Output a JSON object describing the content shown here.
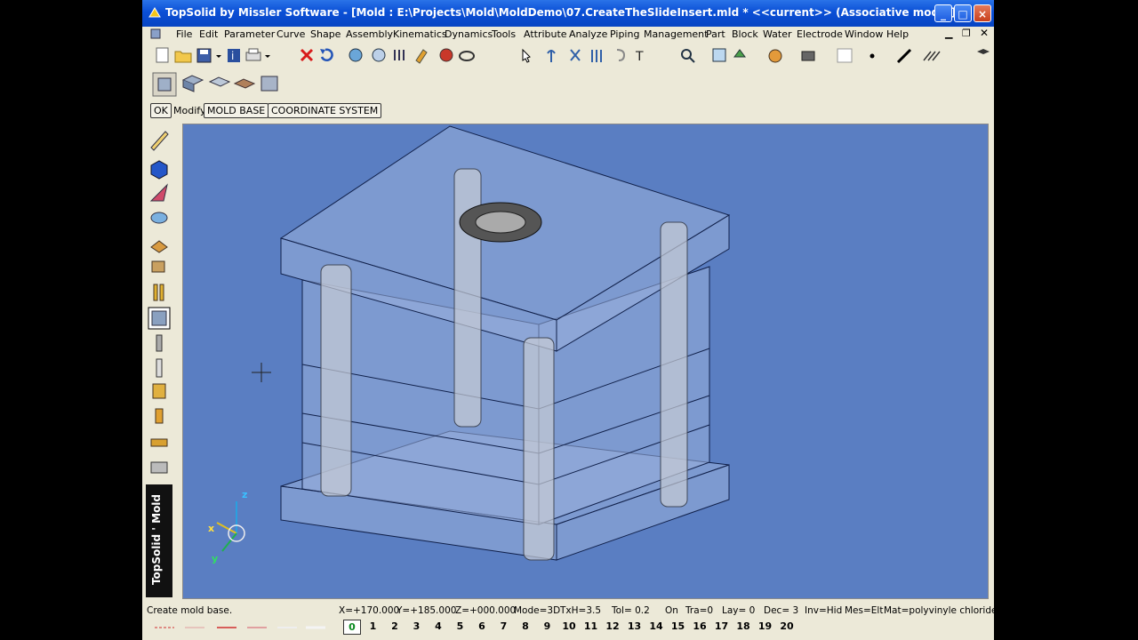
{
  "window": {
    "title": "TopSolid by Missler Software - [Mold : E:\\Projects\\Mold\\MoldDemo\\07.CreateTheSlideInsert.mld *  <<current>> (Associative mode)]",
    "buttons": {
      "minimize": "_",
      "maximize": "□",
      "close": "×"
    }
  },
  "menu": {
    "items": [
      "File",
      "Edit",
      "Parameter",
      "Curve",
      "Shape",
      "Assembly",
      "Kinematics",
      "Dynamics",
      "Tools",
      "Attribute",
      "Analyze",
      "Piping",
      "Management",
      "Part",
      "Block",
      "Water",
      "Electrode",
      "Window",
      "Help"
    ]
  },
  "modify_bar": {
    "ok_label": "OK",
    "modify_label": "Modify:",
    "mold_base_label": "MOLD BASE",
    "coordinate_system_label": "COORDINATE SYSTEM"
  },
  "brand": {
    "text": "TopSolid ' Mold"
  },
  "viewport": {
    "axis_labels": {
      "x": "x",
      "y": "y",
      "z": "z"
    }
  },
  "status": {
    "message": "Create mold base.",
    "x": "X=+170.000",
    "y": "Y=+185.000",
    "z": "Z=+000.000",
    "mode": "Mode=3D",
    "txh": "TxH=3.5",
    "tol": "Tol=  0.2",
    "on": "On",
    "tra": "Tra=0",
    "lay": "Lay=  0",
    "dec": "Dec= 3",
    "inv": "Inv=Hid",
    "mes": "Mes=Elt",
    "mat": "Mat=polyvinyle chloride (s"
  },
  "layers": {
    "numbers": [
      "0",
      "1",
      "2",
      "3",
      "4",
      "5",
      "6",
      "7",
      "8",
      "9",
      "10",
      "11",
      "12",
      "13",
      "14",
      "15",
      "16",
      "17",
      "18",
      "19",
      "20"
    ]
  },
  "colors": {
    "title_bar": "#0a4fd6",
    "viewport_bg": "#5a7ec2",
    "chrome": "#ece9d8"
  }
}
